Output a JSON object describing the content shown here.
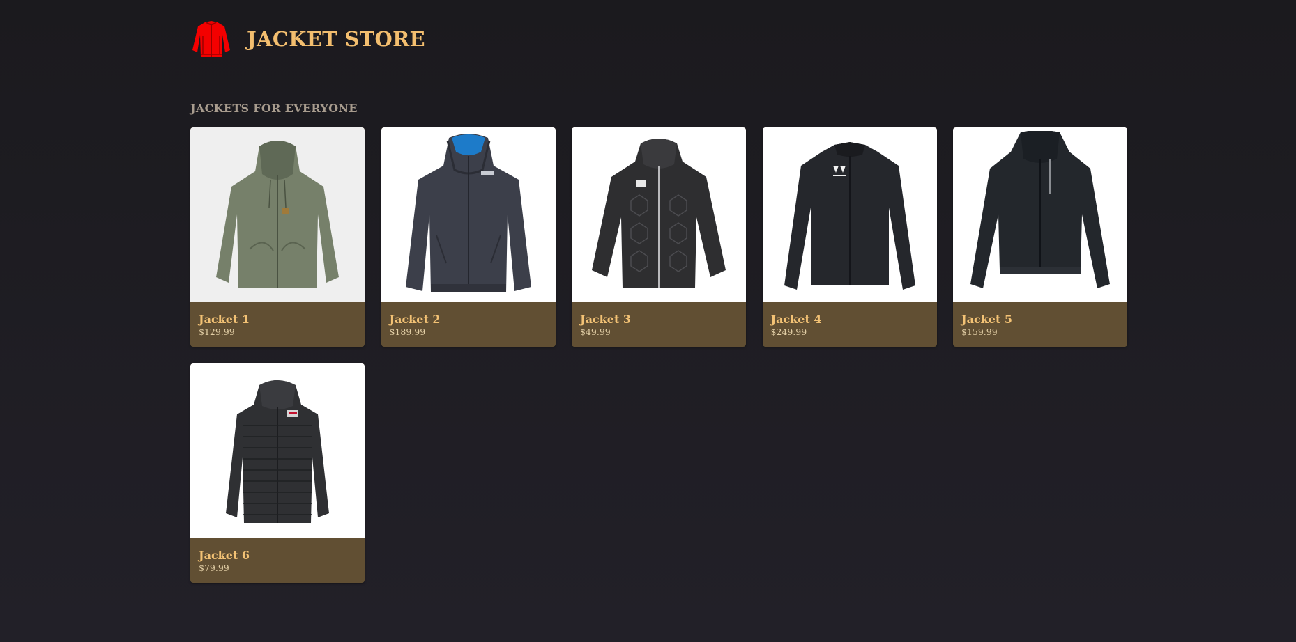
{
  "header": {
    "logo_icon": "jacket-logo-icon",
    "logo_color": "#f40000",
    "title": "JACKET STORE"
  },
  "section": {
    "title": "JACKETS FOR EVERYONE"
  },
  "products": [
    {
      "name": "Jacket 1",
      "price": "$129.99",
      "image_icon": "green-hooded-jacket-image"
    },
    {
      "name": "Jacket 2",
      "price": "$189.99",
      "image_icon": "navy-hooded-jacket-image"
    },
    {
      "name": "Jacket 3",
      "price": "$49.99",
      "image_icon": "quilted-hooded-jacket-image"
    },
    {
      "name": "Jacket 4",
      "price": "$249.99",
      "image_icon": "black-track-jacket-image"
    },
    {
      "name": "Jacket 5",
      "price": "$159.99",
      "image_icon": "black-shell-jacket-image"
    },
    {
      "name": "Jacket 6",
      "price": "$79.99",
      "image_icon": "puffer-jacket-image"
    }
  ],
  "colors": {
    "accent": "#f3be6f",
    "card_footer": "#614f33",
    "background": "#1b1a1e"
  }
}
